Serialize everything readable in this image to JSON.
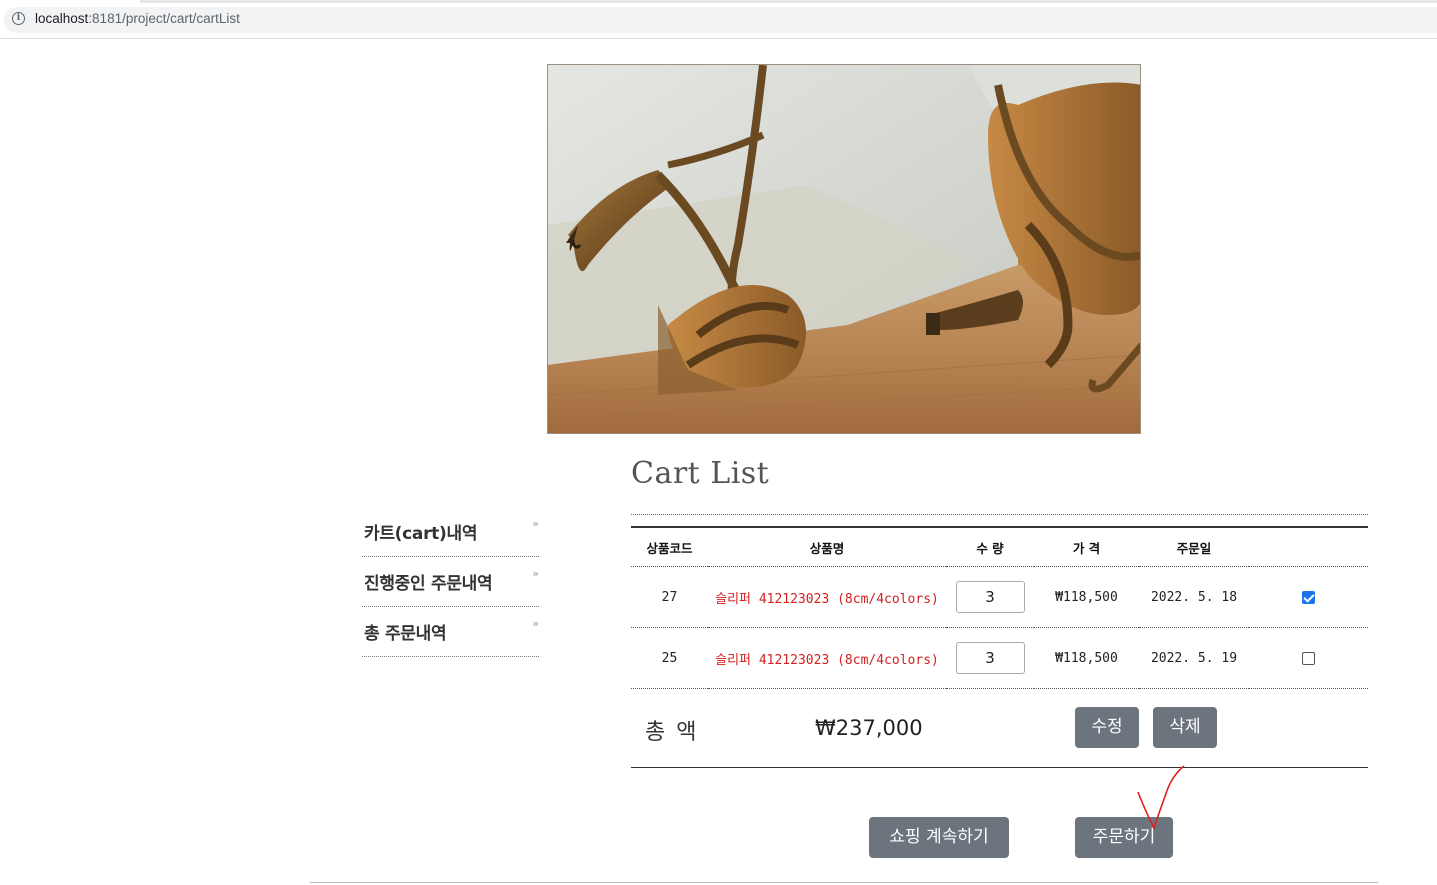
{
  "browser": {
    "url_host": "localhost",
    "url_path": ":8181/project/cart/cartList"
  },
  "hero": {
    "image": "bronze strappy high-heel sandals on wooden floor with linen cushion"
  },
  "page": {
    "title": "Cart List"
  },
  "sidebar": {
    "items": [
      {
        "label": "카트(cart)내역",
        "chevron": "»"
      },
      {
        "label": "진행중인 주문내역",
        "chevron": "»"
      },
      {
        "label": "총 주문내역",
        "chevron": "»"
      }
    ]
  },
  "cart": {
    "headers": [
      "상품코드",
      "상품명",
      "수 량",
      "가 격",
      "주문일",
      ""
    ],
    "rows": [
      {
        "code": "27",
        "name": "슬리퍼 412123023 (8cm/4colors)",
        "qty": "3",
        "price": "₩118,500",
        "date": "2022. 5. 18",
        "checked": true
      },
      {
        "code": "25",
        "name": "슬리퍼 412123023 (8cm/4colors)",
        "qty": "3",
        "price": "₩118,500",
        "date": "2022. 5. 19",
        "checked": false
      }
    ],
    "total_label": "총 액",
    "total_value": "₩237,000",
    "edit_label": "수정",
    "delete_label": "삭제"
  },
  "actions": {
    "continue_label": "쇼핑 계속하기",
    "order_label": "주문하기"
  },
  "colors": {
    "button_bg": "#6c757d",
    "product_name": "#d42020",
    "checkbox_checked": "#1a73e8",
    "annotation_mark": "#e02020"
  }
}
